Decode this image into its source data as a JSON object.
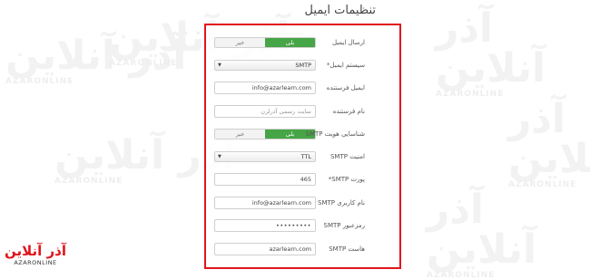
{
  "page": {
    "title": "تنظیمات ایمیل"
  },
  "watermark": {
    "logo_text": "آذر آنلاین",
    "logo_sub": "AZARONLINE"
  },
  "form": {
    "send_email": {
      "label": "ارسال ایمیل",
      "options": [
        "بلی",
        "خیر"
      ],
      "selected": "بلی"
    },
    "email_system": {
      "label": "سیستم ایمیل",
      "required_mark": "*",
      "value": "SMTP"
    },
    "sender_email": {
      "label": "ایمیل فرستنده",
      "value": "info@azarlearn.com"
    },
    "sender_name": {
      "label": "نام فرستنده",
      "placeholder": "سایت رسمی آذرلرن"
    },
    "smtp_auth": {
      "label": "شناسایی هویت SMTP",
      "options": [
        "بلی",
        "خیر"
      ],
      "selected": "بلی"
    },
    "smtp_security": {
      "label": "امنیت SMTP",
      "value": "TTL"
    },
    "smtp_port": {
      "label": "پورت SMTP",
      "required_mark": "*",
      "value": "465"
    },
    "smtp_username": {
      "label": "نام کاربری SMTP",
      "value": "info@azarlearn.com"
    },
    "smtp_password": {
      "label": "رمزعبور SMTP",
      "value": "•••••••••"
    },
    "smtp_host": {
      "label": "هاست SMTP",
      "value": "azarlearn.com"
    }
  },
  "colors": {
    "accent_toggle": "#46a546",
    "highlight_border": "#e0151b"
  }
}
